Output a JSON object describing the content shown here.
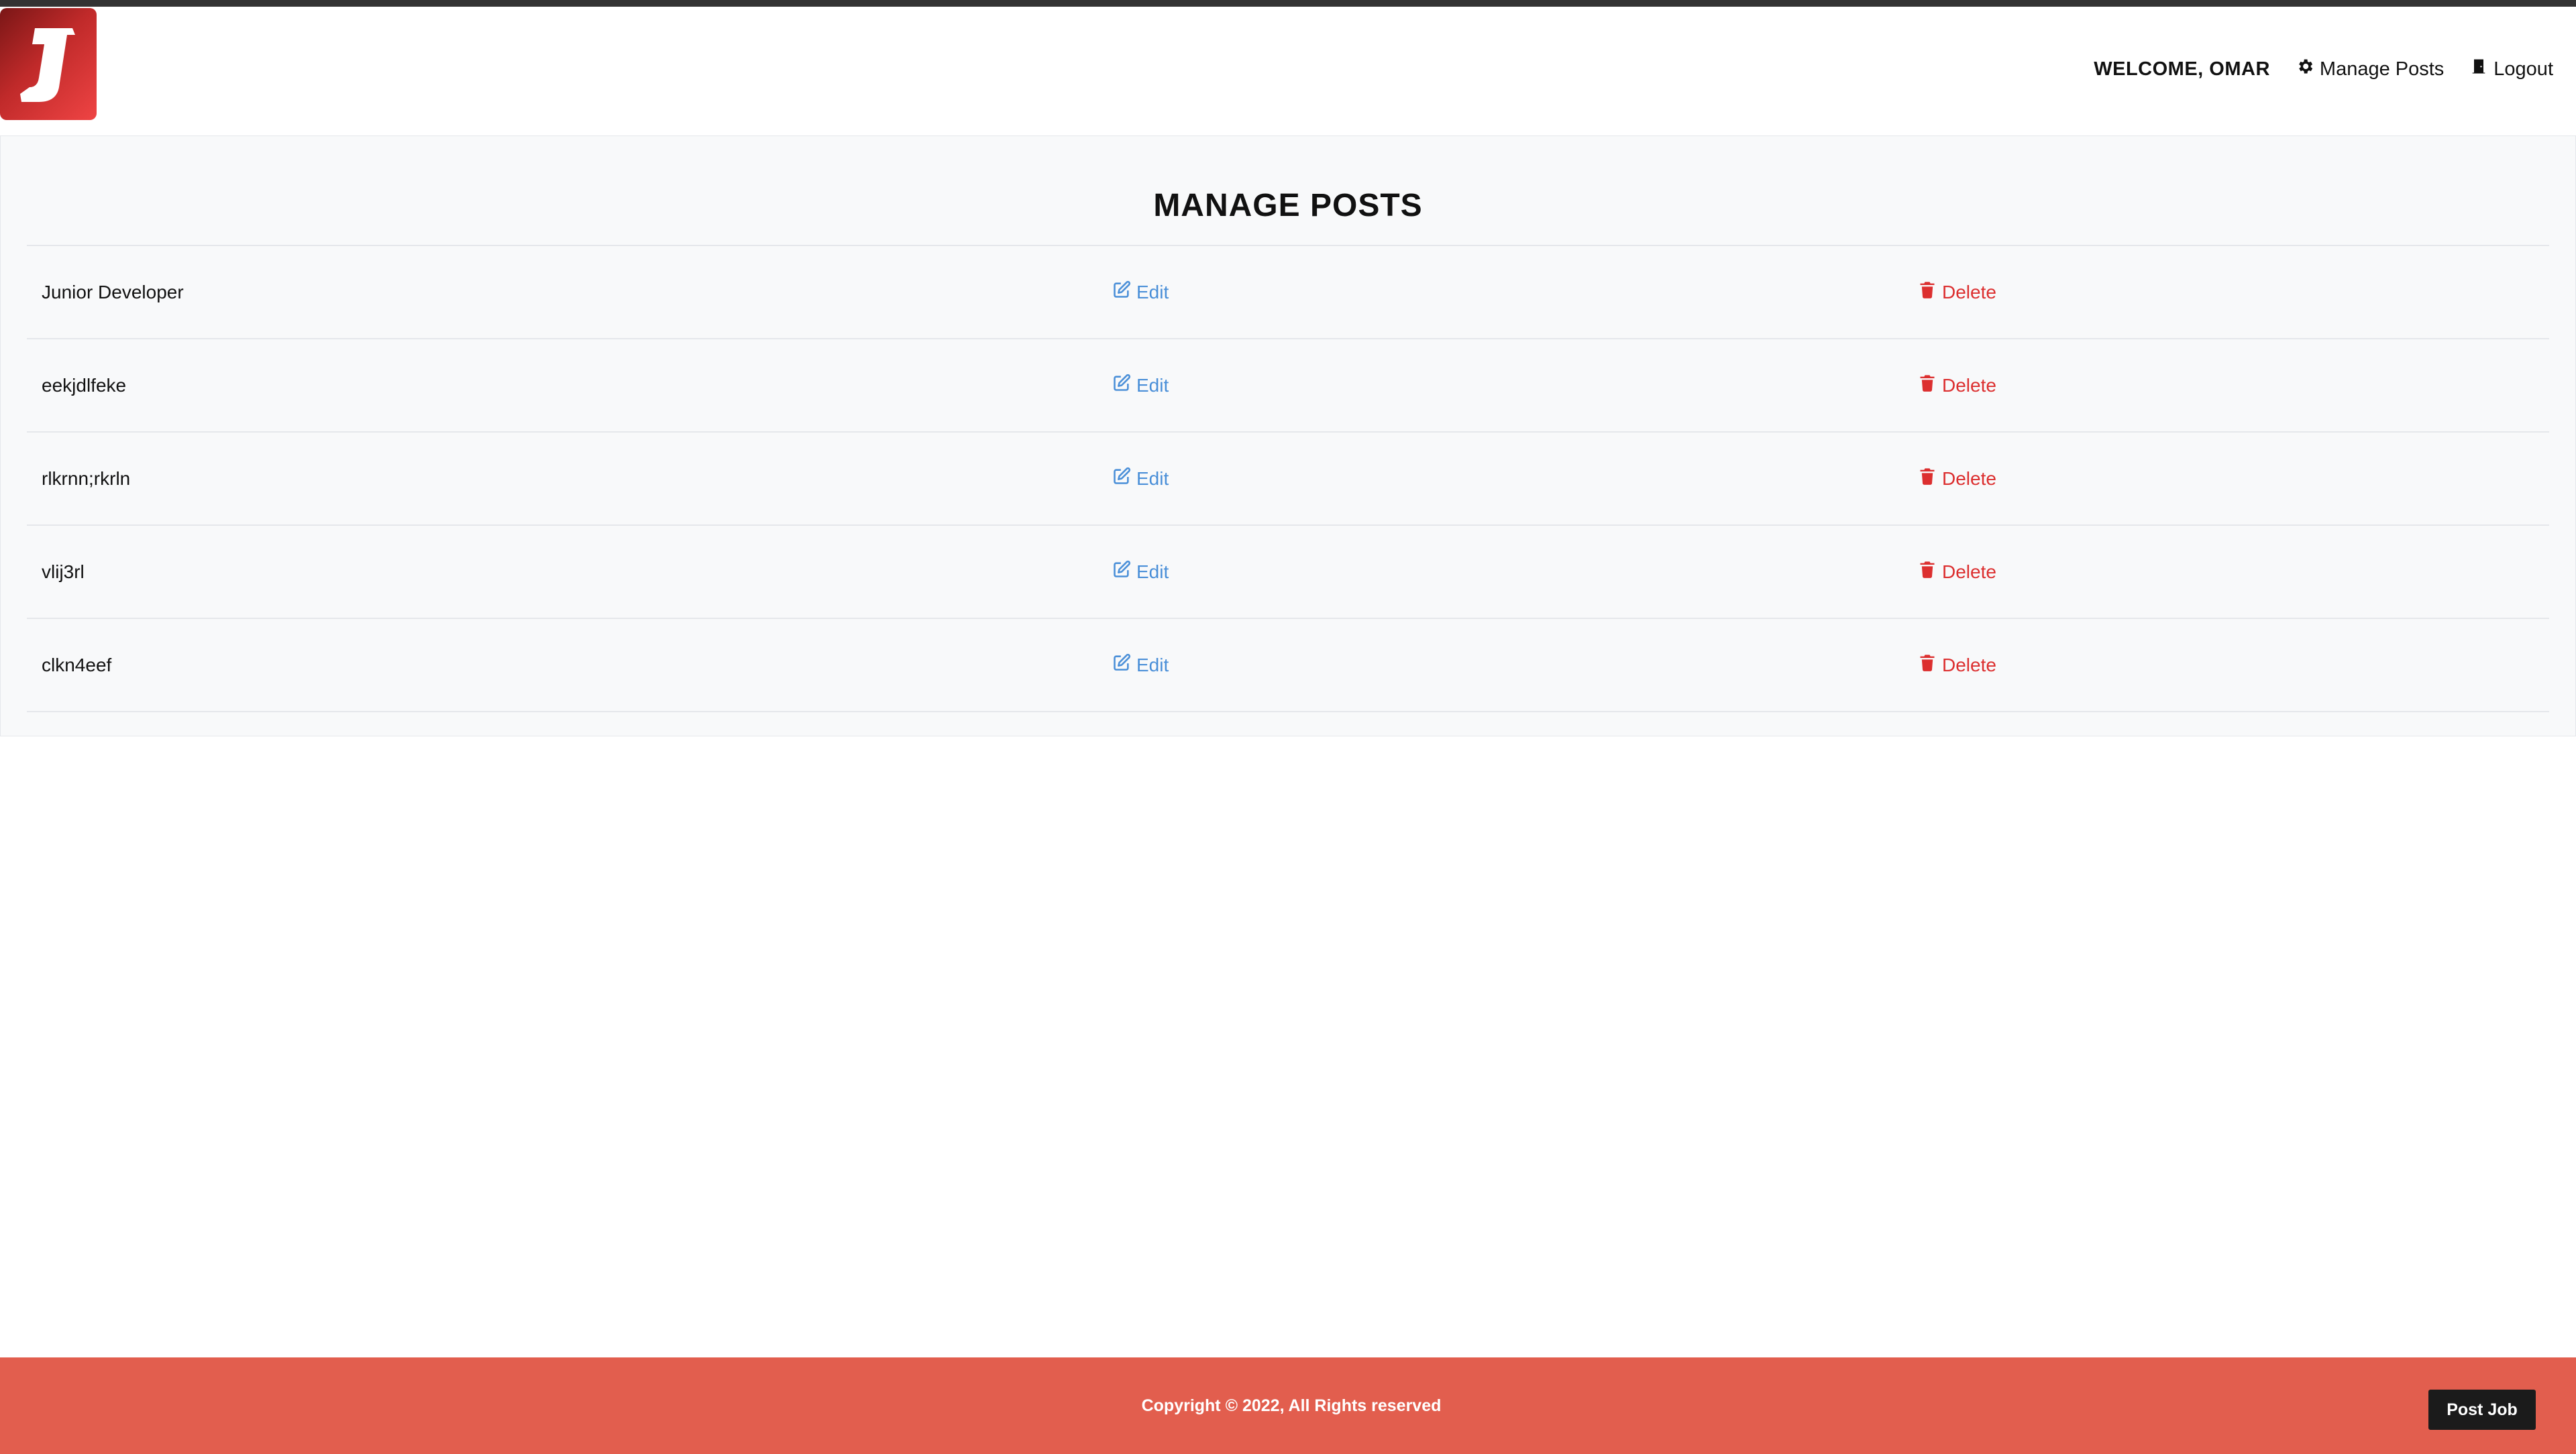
{
  "header": {
    "welcome": "WELCOME, OMAR",
    "nav": {
      "manage_posts": "Manage Posts",
      "logout": "Logout"
    },
    "icons": {
      "logo": "logo-icon",
      "manage_posts": "gear-icon",
      "logout": "door-icon"
    }
  },
  "main": {
    "title": "MANAGE POSTS",
    "rows": [
      {
        "title": "Junior Developer",
        "edit": "Edit",
        "delete": "Delete"
      },
      {
        "title": "eekjdlfeke",
        "edit": "Edit",
        "delete": "Delete"
      },
      {
        "title": "rlkrnn;rkrln",
        "edit": "Edit",
        "delete": "Delete"
      },
      {
        "title": "vlij3rl",
        "edit": "Edit",
        "delete": "Delete"
      },
      {
        "title": "clkn4eef",
        "edit": "Edit",
        "delete": "Delete"
      }
    ],
    "row_icons": {
      "edit": "edit-icon",
      "delete": "trash-icon"
    }
  },
  "footer": {
    "copyright": "Copyright © 2022, All Rights reserved",
    "post_job": "Post Job"
  },
  "colors": {
    "brand_red": "#e25e4e",
    "link_blue": "#4a8fd8",
    "delete_red": "#dc2f2f",
    "logo_red": "#ef4444"
  }
}
